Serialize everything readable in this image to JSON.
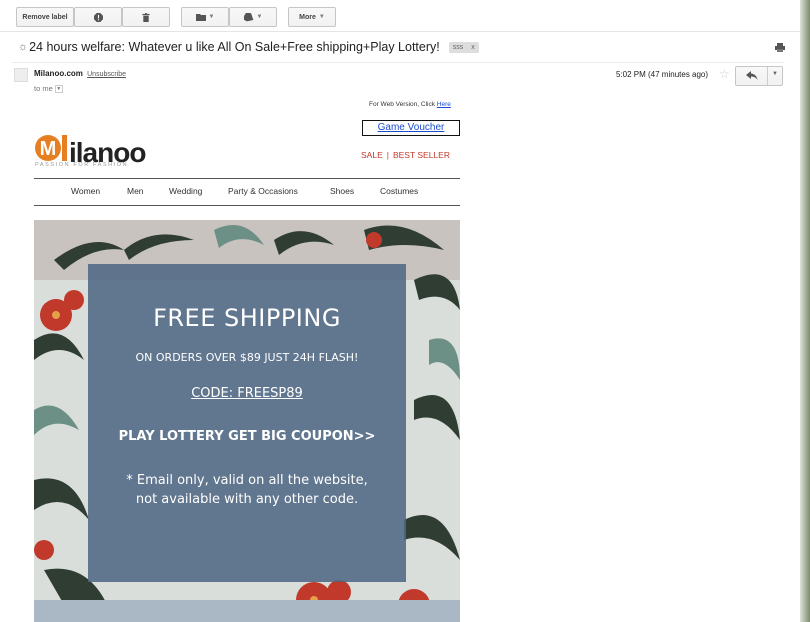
{
  "toolbar": {
    "remove_label": "Remove label",
    "more": "More"
  },
  "subject": {
    "text": "24 hours welfare: Whatever u like All On Sale+Free shipping+Play Lottery!",
    "label": "sss",
    "label_close": "x"
  },
  "message": {
    "sender": "Milanoo.com",
    "unsubscribe": "Unsubscribe",
    "to": "to me",
    "time": "5:02 PM (47 minutes ago)"
  },
  "email": {
    "web_version_prefix": "For Web Version, Click",
    "web_version_link": "Here",
    "game_voucher": "Game Voucher",
    "logo_text": "ilanoo",
    "logo_m": "M",
    "tagline": "PASSION FOR FASHION",
    "sale": "SALE",
    "separator": "|",
    "best_seller": "BEST SELLER",
    "nav": [
      "Women",
      "Men",
      "Wedding",
      "Party & Occasions",
      "Shoes",
      "Costumes"
    ],
    "banner": {
      "title": "FREE SHIPPING",
      "subtitle": "ON ORDERS OVER $89 JUST 24H FLASH!",
      "code": "CODE: FREESP89",
      "lottery": "PLAY LOTTERY GET BIG COUPON>>",
      "note_line1": "* Email only, valid on all the website,",
      "note_line2": "not available with any other code."
    }
  },
  "colors": {
    "brand_orange": "#e67e22",
    "sale_red": "#c0392b",
    "link_blue": "#1a4ccf",
    "panel": "#50688 4"
  }
}
